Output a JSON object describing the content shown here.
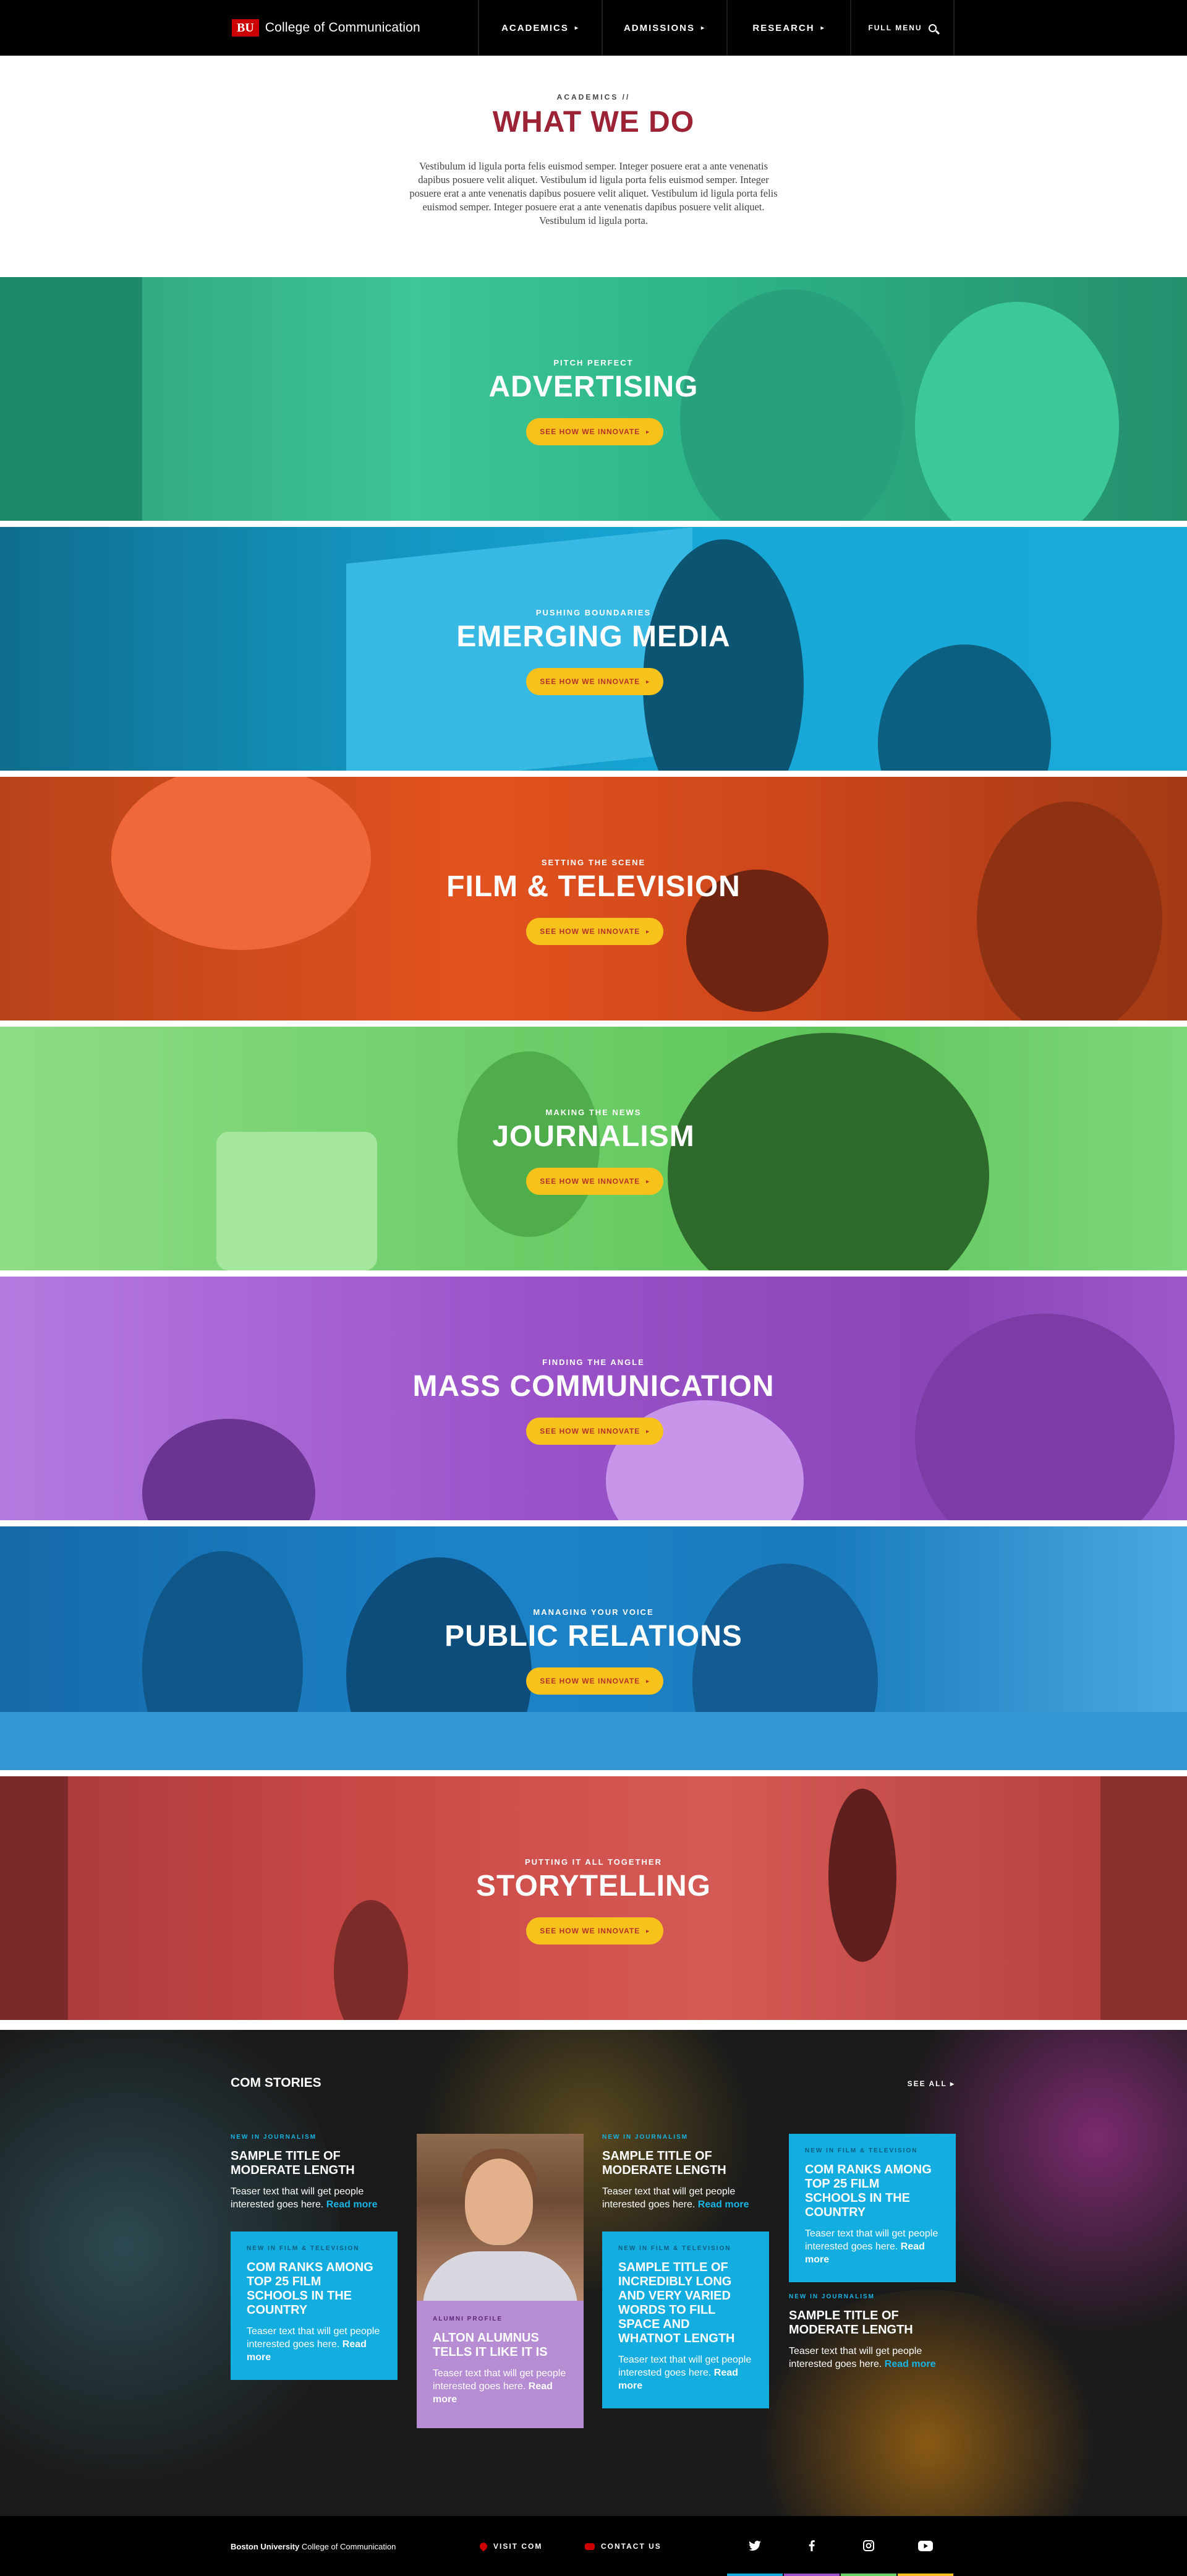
{
  "header": {
    "logo": "BU",
    "college": "College of Communication",
    "nav": [
      {
        "label": "ACADEMICS",
        "chevron": "▸"
      },
      {
        "label": "ADMISSIONS",
        "chevron": "▸"
      },
      {
        "label": "RESEARCH",
        "chevron": "▸"
      }
    ],
    "full_menu": "FULL MENU",
    "icons": {
      "search": "search-icon"
    }
  },
  "intro": {
    "eyebrow": "ACADEMICS //",
    "title": "WHAT WE DO",
    "body": "Vestibulum id ligula porta felis euismod semper. Integer posuere erat a ante venenatis dapibus posuere velit aliquet. Vestibulum id ligula porta felis euismod semper. Integer posuere erat a ante venenatis dapibus posuere velit aliquet. Vestibulum id ligula porta felis euismod semper. Integer posuere erat a ante venenatis dapibus posuere velit aliquet. Vestibulum id ligula porta."
  },
  "programs": [
    {
      "kicker": "PITCH PERFECT",
      "title": "ADVERTISING",
      "cta": "SEE HOW WE INNOVATE",
      "arrow": "▸",
      "color": "#2fb98b"
    },
    {
      "kicker": "PUSHING BOUNDARIES",
      "title": "EMERGING MEDIA",
      "cta": "SEE HOW WE INNOVATE",
      "arrow": "▸",
      "color": "#18a8d8"
    },
    {
      "kicker": "SETTING THE SCENE",
      "title": "FILM & TELEVISION",
      "cta": "SEE HOW WE INNOVATE",
      "arrow": "▸",
      "color": "#e2521e"
    },
    {
      "kicker": "MAKING THE NEWS",
      "title": "JOURNALISM",
      "cta": "SEE HOW WE INNOVATE",
      "arrow": "▸",
      "color": "#6fcf6a"
    },
    {
      "kicker": "FINDING THE ANGLE",
      "title": "MASS COMMUNICATION",
      "cta": "SEE HOW WE INNOVATE",
      "arrow": "▸",
      "color": "#9b52c9"
    },
    {
      "kicker": "MANAGING YOUR VOICE",
      "title": "PUBLIC RELATIONS",
      "cta": "SEE HOW WE INNOVATE",
      "arrow": "▸",
      "color": "#1c83c8"
    },
    {
      "kicker": "PUTTING IT ALL TOGETHER",
      "title": "STORYTELLING",
      "cta": "SEE HOW WE INNOVATE",
      "arrow": "▸",
      "color": "#cc4a47"
    }
  ],
  "stories": {
    "heading": "COM STORIES",
    "see_all": "SEE ALL",
    "see_all_arrow": "▸",
    "cards": [
      {
        "kicker": "NEW IN JOURNALISM",
        "title": "Sample title of moderate length",
        "body": "Teaser text that will get people interested goes here.",
        "read_more": "Read more"
      },
      {
        "kicker": "NEW IN FILM & TELEVISION",
        "title": "COM ranks among top 25 film schools in the country",
        "body": "Teaser text that will get people interested goes here.",
        "read_more": "Read more"
      },
      {
        "kicker": "ALUMNI PROFILE",
        "title": "Alton alumnus tells it like it is",
        "body": "Teaser text that will get people interested goes here.",
        "read_more": "Read more"
      },
      {
        "kicker": "NEW IN JOURNALISM",
        "title": "Sample title of moderate length",
        "body": "Teaser text that will get people interested goes here.",
        "read_more": "Read more"
      },
      {
        "kicker": "NEW IN FILM & TELEVISION",
        "title": "Sample title of incredibly long and very varied words to fill space and whatnot length",
        "body": "Teaser text that will get people interested goes here.",
        "read_more": "Read more"
      },
      {
        "kicker": "NEW IN FILM & TELEVISION",
        "title": "COM ranks among top 25 film schools in the country",
        "body": "Teaser text that will get people interested goes here.",
        "read_more": "Read more"
      },
      {
        "kicker": "NEW IN JOURNALISM",
        "title": "Sample title of moderate length",
        "body": "Teaser text that will get people interested goes here.",
        "read_more": "Read more"
      }
    ]
  },
  "footer": {
    "brand_bold": "Boston University",
    "brand_rest": " College of Communication",
    "visit": "VISIT COM",
    "contact": "CONTACT US",
    "social": [
      "twitter-icon",
      "facebook-icon",
      "instagram-icon",
      "youtube-icon"
    ],
    "stripe_colors": [
      "#18a8d8",
      "#9b52c9",
      "#6fcf6a",
      "#f8c21c"
    ]
  }
}
